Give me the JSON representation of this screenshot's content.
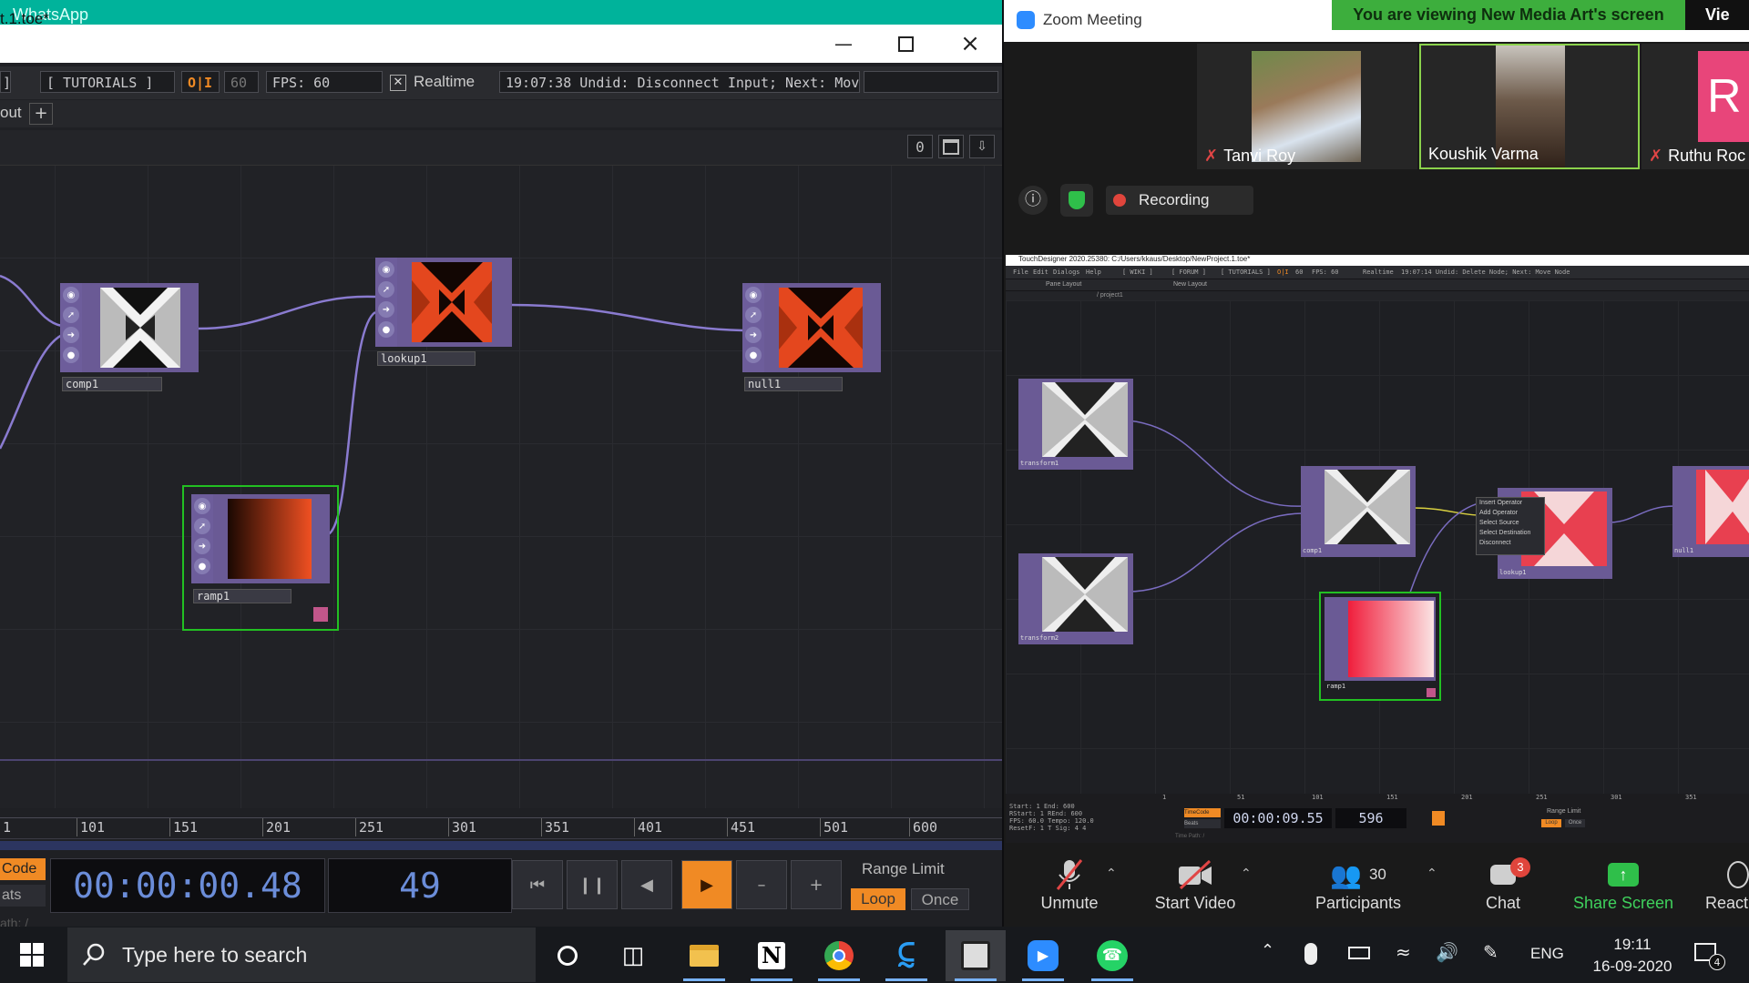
{
  "whatsapp_title": "WhatsApp",
  "td": {
    "window_title": "t.1.toe*",
    "toolbar": {
      "bracket": "]",
      "tutorials": "[ TUTORIALS ]",
      "oi": "O|I",
      "fps_cap": "60",
      "fps_label": "FPS:  60",
      "realtime": "Realtime",
      "status": "19:07:38 Undid: Disconnect Input; Next: Mov"
    },
    "pane_label": "out",
    "net_counter": "0",
    "nodes": {
      "comp": "comp1",
      "lookup": "lookup1",
      "null": "null1",
      "ramp": "ramp1"
    },
    "ruler_ticks": [
      "1",
      "101",
      "151",
      "201",
      "251",
      "301",
      "351",
      "401",
      "451",
      "501",
      "600"
    ],
    "timecode": "00:00:00.48",
    "frame": "49",
    "code_label": "Code",
    "ats_label": "ats",
    "path_label": "ath: /",
    "range_limit": "Range Limit",
    "loop": "Loop",
    "once": "Once"
  },
  "zoom": {
    "title": "Zoom Meeting",
    "banner": "You are viewing New Media Art's screen",
    "view_options": "Vie",
    "participants": [
      {
        "name": "Tanvi Roy",
        "muted": true
      },
      {
        "name": "Koushik Varma",
        "muted": false,
        "speaking": true
      },
      {
        "name": "Ruthu Roc",
        "muted": true,
        "initial": "R"
      }
    ],
    "recording": "Recording",
    "shared": {
      "titlebar": "TouchDesigner 2020.25380: C:/Users/kkaus/Desktop/NewProject.1.toe*",
      "menu": [
        "File",
        "Edit",
        "Dialogs",
        "Help",
        "[ WIKI ]",
        "[ FORUM ]",
        "[ TUTORIALS ]",
        "O|I",
        "60",
        "FPS:  60",
        "Realtime",
        "19:07:14 Undid: Delete Node; Next: Move Node"
      ],
      "pane_layout": "Pane Layout",
      "new_layout": "New Layout",
      "path": "/ project1",
      "nodes": [
        "transform1",
        "transform2",
        "comp1",
        "lookup1",
        "null1",
        "ramp1"
      ],
      "context_menu": [
        "Insert Operator",
        "Add Operator",
        "Select Source",
        "Select Destination",
        "Disconnect"
      ],
      "timecode": "00:00:09.55",
      "frame": "596",
      "stats": [
        "Start:",
        "1",
        "End:",
        "600",
        "RStart:",
        "1",
        "REnd:",
        "600",
        "FPS:",
        "60.0",
        "Tempo:",
        "120.0",
        "ResetF:",
        "1",
        "T Sig:",
        "4",
        "4"
      ],
      "ruler": [
        "1",
        "51",
        "101",
        "151",
        "201",
        "251",
        "301",
        "351"
      ],
      "range_limit": "Range Limit",
      "loop": "Loop",
      "once": "Once",
      "timecode_label": "TimeCode",
      "beats_label": "Beats",
      "time_path": "Time Path: /"
    },
    "controls": {
      "unmute": "Unmute",
      "start_video": "Start Video",
      "participants": "Participants",
      "participants_count": "30",
      "chat": "Chat",
      "chat_badge": "3",
      "share_screen": "Share Screen",
      "react": "React"
    }
  },
  "taskbar": {
    "search_placeholder": "Type here to search",
    "lang": "ENG",
    "time": "19:11",
    "date": "16-09-2020",
    "notif_count": "4"
  },
  "colors": {
    "whatsapp_green": "#00b39b",
    "zoom_banner": "#3dae3d",
    "td_timecode": "#6b8dd9",
    "td_play": "#f08a24",
    "node_purple": "#6d5d9b",
    "wire": "#8a7bd0",
    "selection": "#22c022"
  }
}
